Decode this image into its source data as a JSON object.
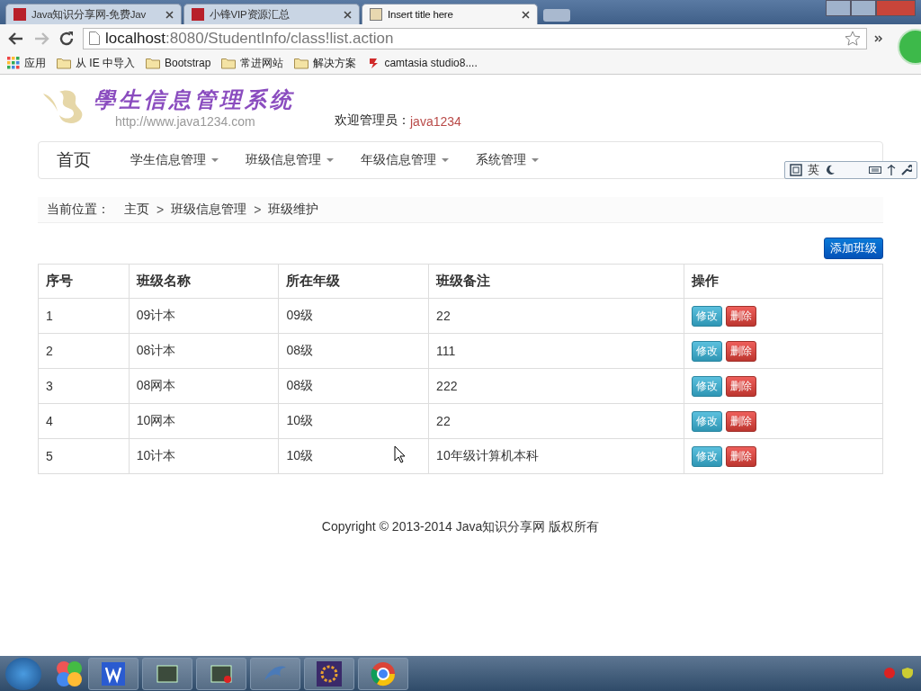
{
  "browser": {
    "tabs": [
      {
        "title": "Java知识分享网-免费Jav",
        "selected": false
      },
      {
        "title": "小锋VIP资源汇总",
        "selected": false
      },
      {
        "title": "Insert title here",
        "selected": true
      }
    ],
    "address": {
      "host": "localhost",
      "path": ":8080/StudentInfo/class!list.action"
    },
    "bookmarks": [
      {
        "label": "应用",
        "kind": "apps"
      },
      {
        "label": "从 IE 中导入",
        "kind": "folder"
      },
      {
        "label": "Bootstrap",
        "kind": "folder"
      },
      {
        "label": "常进网站",
        "kind": "folder"
      },
      {
        "label": "解决方案",
        "kind": "folder"
      },
      {
        "label": "camtasia studio8....",
        "kind": "site"
      }
    ]
  },
  "header": {
    "logo_title": "學生信息管理系统",
    "logo_url": "http://www.java1234.com",
    "welcome_label": "欢迎管理员：",
    "username": "java1234"
  },
  "navbar": {
    "brand": "首页",
    "menus": [
      "学生信息管理",
      "班级信息管理",
      "年级信息管理",
      "系统管理"
    ]
  },
  "breadcrumb": {
    "label": "当前位置：",
    "items": [
      "主页",
      "班级信息管理",
      "班级维护"
    ],
    "separator": ">"
  },
  "add_button": "添加班级",
  "table": {
    "columns": [
      "序号",
      "班级名称",
      "所在年级",
      "班级备注",
      "操作"
    ],
    "rows": [
      {
        "cells": [
          "1",
          "09计本",
          "09级",
          "22"
        ],
        "edit_label": "修改",
        "delete_label": "删除"
      },
      {
        "cells": [
          "2",
          "08计本",
          "08级",
          "111"
        ],
        "edit_label": "修改",
        "delete_label": "删除"
      },
      {
        "cells": [
          "3",
          "08网本",
          "08级",
          "222"
        ],
        "edit_label": "修改",
        "delete_label": "删除"
      },
      {
        "cells": [
          "4",
          "10网本",
          "10级",
          "22"
        ],
        "edit_label": "修改",
        "delete_label": "删除"
      },
      {
        "cells": [
          "5",
          "10计本",
          "10级",
          "10年级计算机本科"
        ],
        "edit_label": "修改",
        "delete_label": "删除"
      }
    ]
  },
  "footer": "Copyright © 2013-2014 Java知识分享网 版权所有",
  "ime_toolbar": {
    "mode": "英"
  }
}
